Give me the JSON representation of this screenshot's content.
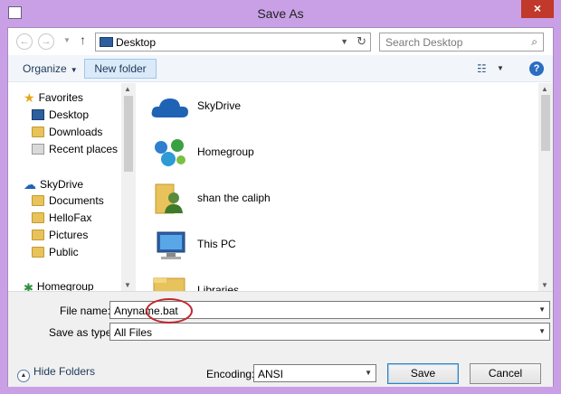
{
  "window": {
    "title": "Save As",
    "close_glyph": "×"
  },
  "address": {
    "back_glyph": "←",
    "forward_glyph": "→",
    "up_glyph": "↑",
    "location": "Desktop",
    "search_placeholder": "Search Desktop"
  },
  "toolbar": {
    "organize_label": "Organize",
    "new_folder_label": "New folder",
    "help_glyph": "?"
  },
  "nav": {
    "items": [
      {
        "label": "Favorites",
        "icon": "star-icon"
      },
      {
        "label": "Desktop",
        "icon": "desktop-icon"
      },
      {
        "label": "Downloads",
        "icon": "folder-icon"
      },
      {
        "label": "Recent places",
        "icon": "recent-icon"
      },
      {
        "label": "SkyDrive",
        "icon": "cloud-icon"
      },
      {
        "label": "Documents",
        "icon": "folder-icon"
      },
      {
        "label": "HelloFax",
        "icon": "folder-icon"
      },
      {
        "label": "Pictures",
        "icon": "folder-icon"
      },
      {
        "label": "Public",
        "icon": "folder-icon"
      },
      {
        "label": "Homegroup",
        "icon": "homegroup-icon"
      }
    ]
  },
  "files": [
    {
      "label": "SkyDrive",
      "icon": "skydrive-icon"
    },
    {
      "label": "Homegroup",
      "icon": "homegroup-icon"
    },
    {
      "label": "shan the caliph",
      "icon": "user-folder-icon"
    },
    {
      "label": "This PC",
      "icon": "computer-icon"
    },
    {
      "label": "Libraries",
      "icon": "libraries-icon"
    }
  ],
  "form": {
    "file_name_label": "File name:",
    "file_name_value": "Anyname.bat",
    "save_type_label": "Save as type:",
    "save_type_value": "All Files",
    "hide_folders_label": "Hide Folders",
    "encoding_label": "Encoding:",
    "encoding_value": "ANSI",
    "save_label": "Save",
    "cancel_label": "Cancel"
  },
  "colors": {
    "frame": "#c9a0e6",
    "close": "#c0392b",
    "highlight": "#c1272d",
    "accent": "#2a6dc2"
  }
}
